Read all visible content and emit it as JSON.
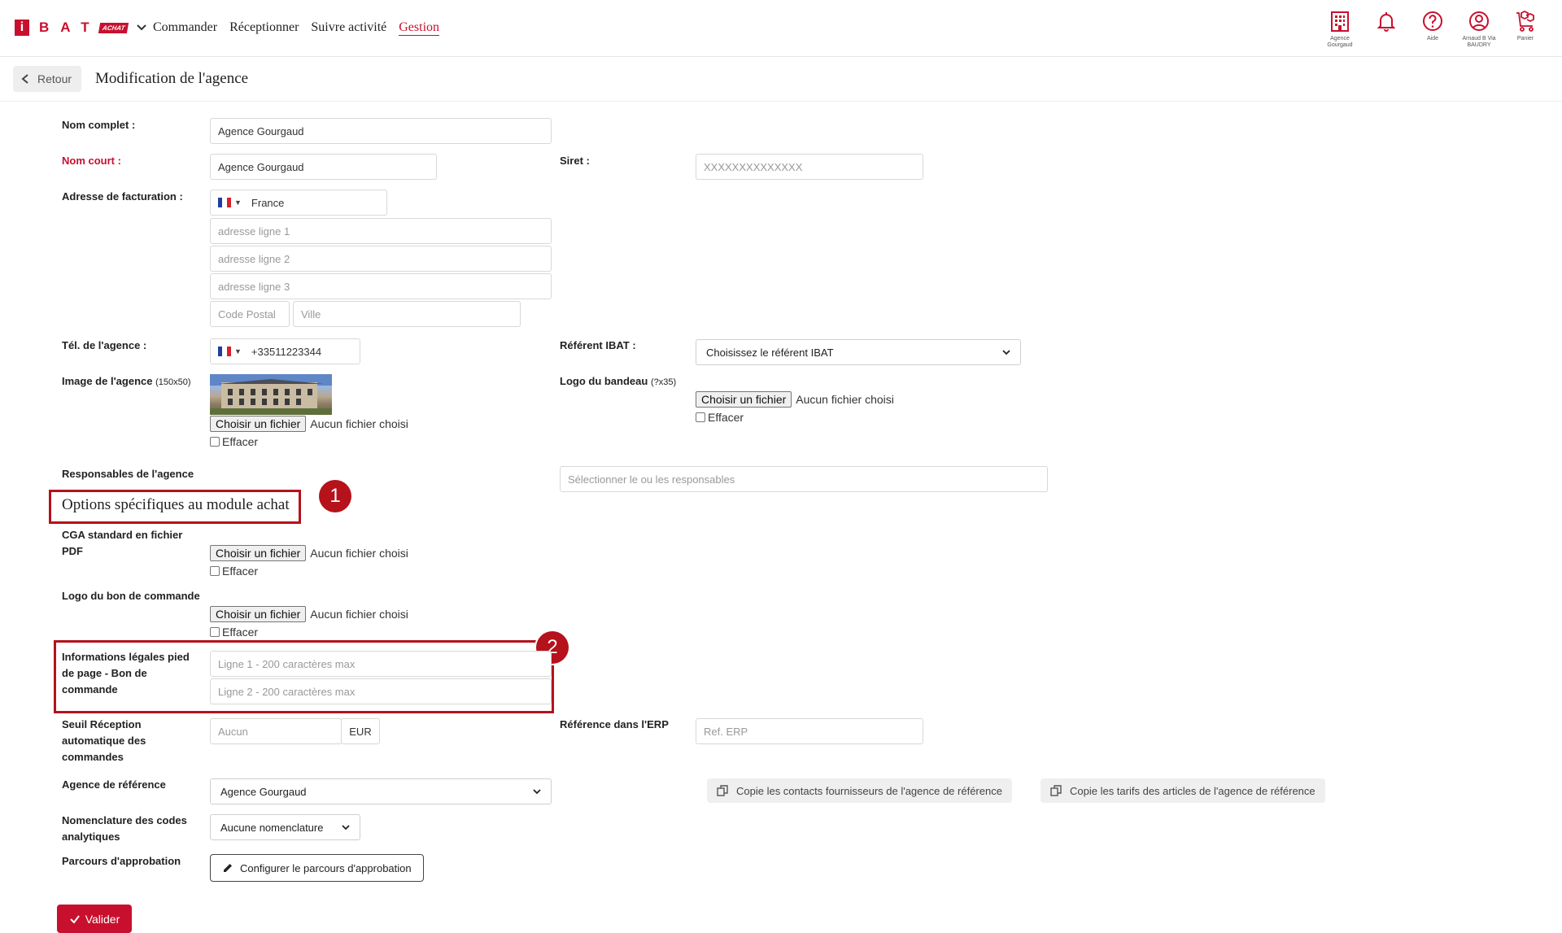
{
  "header": {
    "logo_letters": "BAT",
    "logo_badge": "ACHAT",
    "nav": [
      "Commander",
      "Réceptionner",
      "Suivre activité",
      "Gestion"
    ],
    "icons": [
      {
        "name": "agency-icon",
        "label": "Agence Gourgaud"
      },
      {
        "name": "bell-icon",
        "label": ""
      },
      {
        "name": "help-icon",
        "label": "Aide"
      },
      {
        "name": "user-icon",
        "label": "Arnaud B Via BAUDRY"
      },
      {
        "name": "cart-icon",
        "label": "Panier"
      }
    ]
  },
  "subheader": {
    "back_label": "Retour",
    "title": "Modification de l'agence"
  },
  "form": {
    "nom_complet": {
      "label": "Nom complet :",
      "value": "Agence Gourgaud"
    },
    "nom_court": {
      "label": "Nom court :",
      "value": "Agence Gourgaud"
    },
    "siret": {
      "label": "Siret :",
      "placeholder": "XXXXXXXXXXXXXX"
    },
    "adresse": {
      "label": "Adresse de facturation :",
      "country": "France",
      "ligne1": "adresse ligne 1",
      "ligne2": "adresse ligne 2",
      "ligne3": "adresse ligne 3",
      "cp": "Code Postal",
      "ville": "Ville"
    },
    "tel": {
      "label": "Tél. de l'agence :",
      "value": "+33511223344"
    },
    "referent": {
      "label": "Référent IBAT :",
      "value": "Choisissez le référent IBAT"
    },
    "image": {
      "label": "Image de l'agence",
      "size": "(150x50)"
    },
    "logo_bandeau": {
      "label": "Logo du bandeau",
      "size": "(?x35)"
    },
    "file_button": "Choisir un fichier",
    "file_none": "Aucun fichier choisi",
    "effacer": "Effacer",
    "responsables": {
      "label": "Responsables de l'agence",
      "placeholder": "Sélectionner le ou les responsables"
    },
    "section_title": "Options spécifiques au module achat",
    "cga": {
      "label": "CGA standard en fichier PDF"
    },
    "logo_bdc": {
      "label": "Logo du bon de commande"
    },
    "infos_legales": {
      "label": "Informations légales pied de page - Bon de commande",
      "ligne1": "Ligne 1 - 200 caractères max",
      "ligne2": "Ligne 2 - 200 caractères max"
    },
    "seuil": {
      "label": "Seuil Réception automatique des commandes",
      "placeholder": "Aucun",
      "unit": "EUR"
    },
    "erp": {
      "label": "Référence dans l'ERP",
      "placeholder": "Ref. ERP"
    },
    "agence_ref": {
      "label": "Agence de référence",
      "value": "Agence Gourgaud"
    },
    "copy_contacts": "Copie les contacts fournisseurs de l'agence de référence",
    "copy_tarifs": "Copie les tarifs des articles de l'agence de référence",
    "nomenclature": {
      "label": "Nomenclature des codes analytiques",
      "value": "Aucune nomenclature"
    },
    "parcours": {
      "label": "Parcours d'approbation",
      "button": "Configurer le parcours d'approbation"
    },
    "submit": "Valider"
  },
  "callouts": [
    "1",
    "2"
  ],
  "colors": {
    "brand": "#c8102e",
    "callout": "#b5121b"
  }
}
